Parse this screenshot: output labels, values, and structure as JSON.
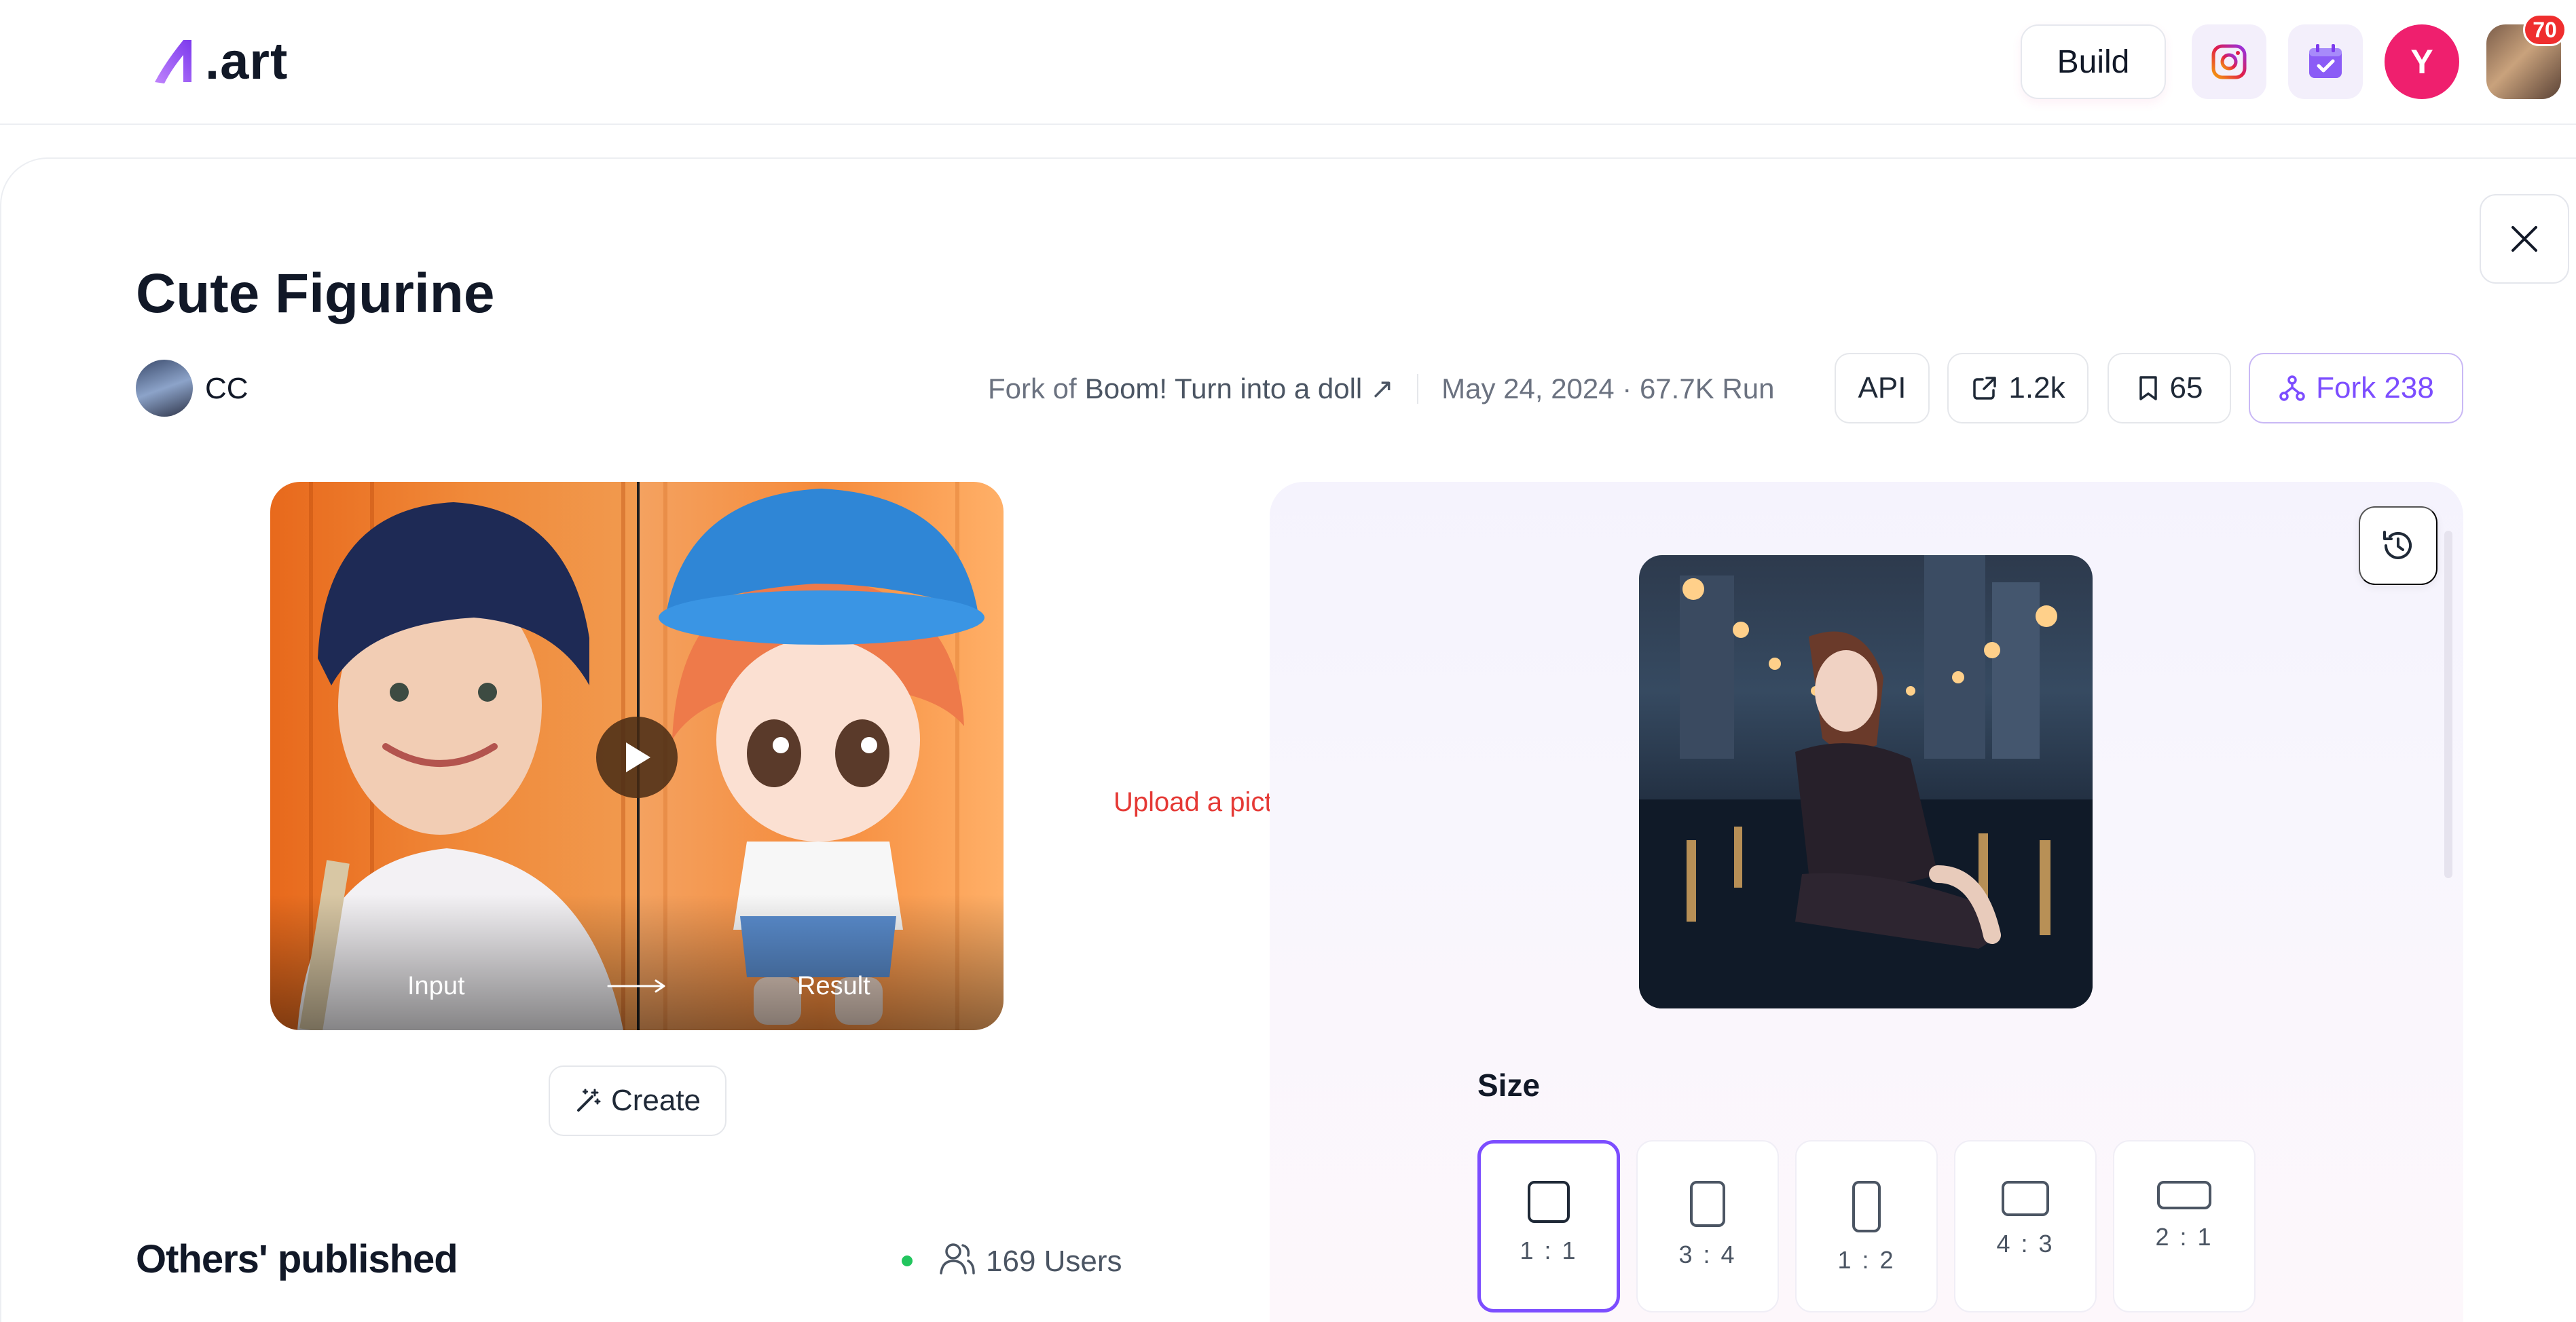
{
  "header": {
    "logo_text": ".art",
    "build_label": "Build",
    "user_initial": "Y",
    "notification_count": "70",
    "icons": [
      "instagram-icon",
      "calendar-check-icon"
    ],
    "accent_color": "#7c4dff",
    "avatar_color": "#ef1f6e"
  },
  "app": {
    "title": "Cute Figurine",
    "author": "CC",
    "fork_prefix": "Fork of",
    "fork_source": "Boom! Turn into a doll ↗",
    "meta": "May 24, 2024 · 67.7K Run",
    "api_label": "API",
    "share_count": "1.2k",
    "bookmark_count": "65",
    "fork_label": "Fork 238"
  },
  "preview": {
    "input_label": "Input",
    "result_label": "Result"
  },
  "create_label": "Create",
  "others": {
    "title": "Others' published",
    "users": "169 Users",
    "online_color": "#22c55e"
  },
  "annotation": {
    "text": "Upload a picture",
    "color": "#e53935"
  },
  "form": {
    "size_label": "Size",
    "selected_ratio": "1 : 1",
    "ratios": [
      {
        "label": "1 : 1"
      },
      {
        "label": "3 : 4"
      },
      {
        "label": "1 : 2"
      },
      {
        "label": "4 : 3"
      },
      {
        "label": "2 : 1"
      }
    ]
  }
}
